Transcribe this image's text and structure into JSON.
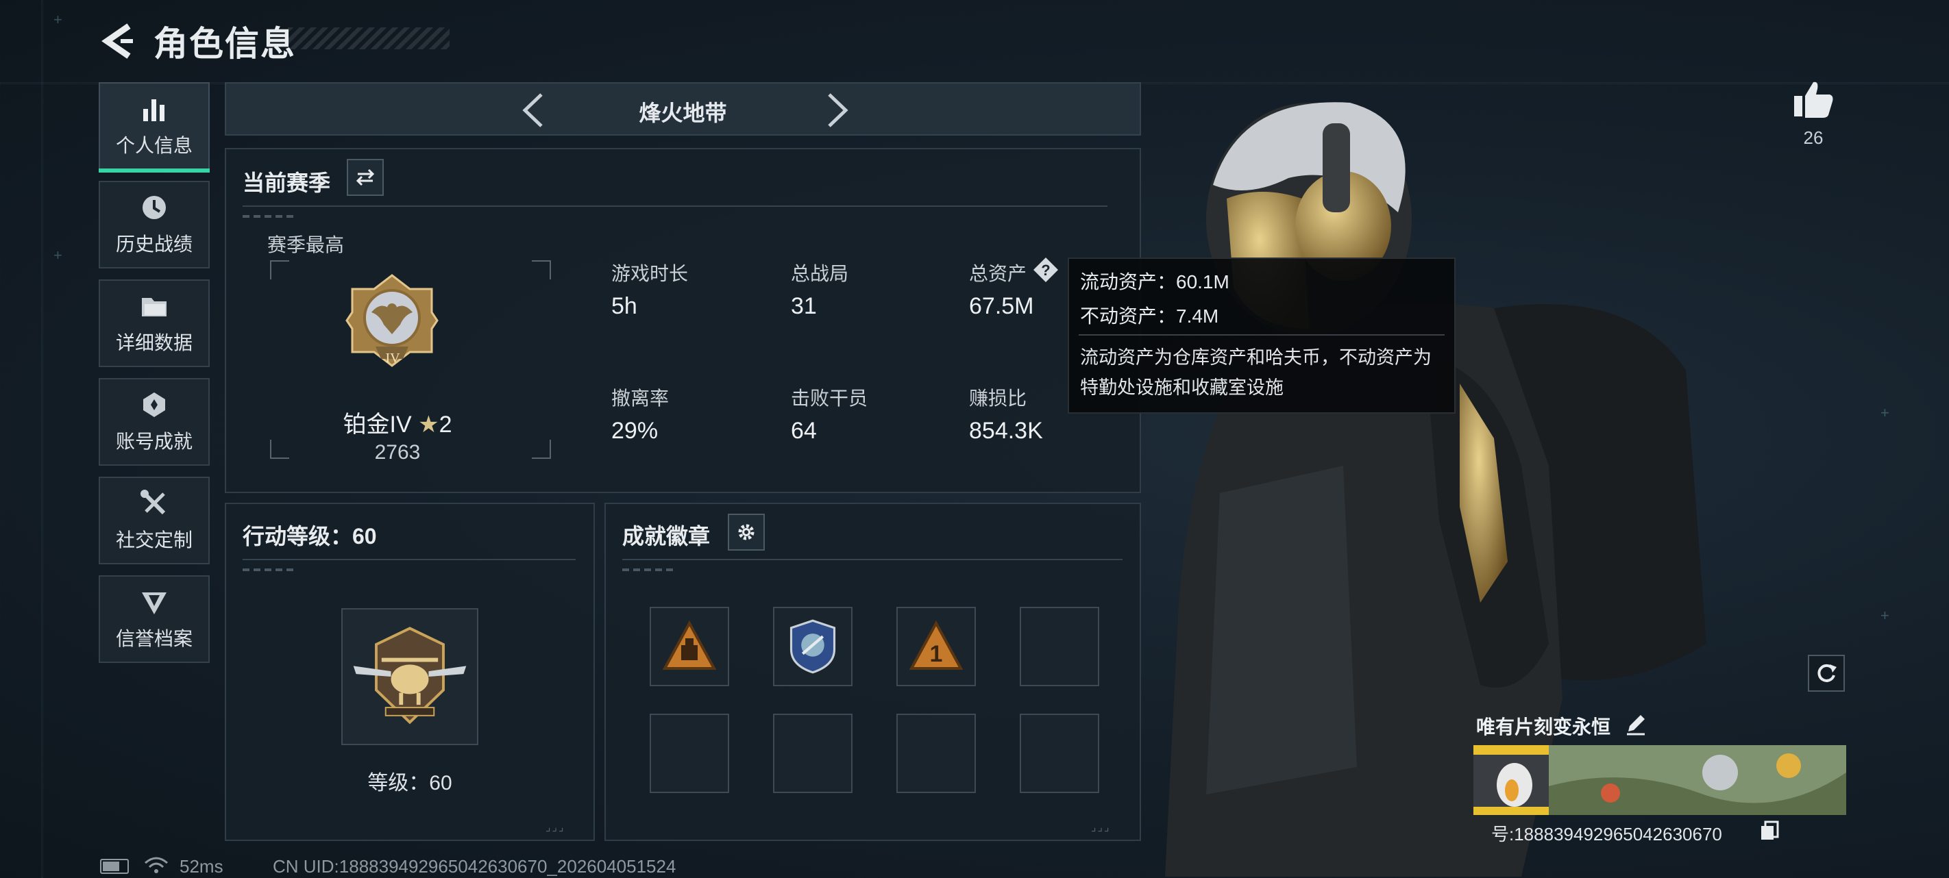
{
  "header": {
    "title": "角色信息"
  },
  "nav": {
    "items": [
      {
        "label": "个人信息",
        "icon": "bar-chart-icon",
        "active": true
      },
      {
        "label": "历史战绩",
        "icon": "history-icon"
      },
      {
        "label": "详细数据",
        "icon": "folder-icon"
      },
      {
        "label": "账号成就",
        "icon": "achievement-icon"
      },
      {
        "label": "社交定制",
        "icon": "tools-icon"
      },
      {
        "label": "信誉档案",
        "icon": "reputation-icon"
      }
    ]
  },
  "mode_selector": {
    "current": "烽火地带"
  },
  "season": {
    "title": "当前赛季",
    "best_label": "赛季最高",
    "rank_name": "铂金IV",
    "rank_stars": "2",
    "rank_score": "2763",
    "rank_emblem_numeral": "IV",
    "stats": [
      {
        "label": "游戏时长",
        "value": "5h"
      },
      {
        "label": "总战局",
        "value": "31"
      },
      {
        "label": "总资产",
        "value": "67.5M"
      },
      {
        "label": "撤离率",
        "value": "29%"
      },
      {
        "label": "击败干员",
        "value": "64"
      },
      {
        "label": "赚损比",
        "value": "854.3K"
      }
    ]
  },
  "tooltip": {
    "liquid": "流动资产：60.1M",
    "fixed": "不动资产：7.4M",
    "description": "流动资产为仓库资产和哈夫币，不动资产为特勤处设施和收藏室设施"
  },
  "action_level": {
    "title": "行动等级：60",
    "level_text": "等级：60"
  },
  "achievements": {
    "title": "成就徽章"
  },
  "likes": {
    "count": "26"
  },
  "profile": {
    "name": "唯有片刻变永恒",
    "id_text": "号:1888394929650426306​70",
    "id_display": "号:188839492965042630670"
  },
  "status_bar": {
    "ping": "52ms",
    "uid": "CN UID:188839492965042630670_202604051524"
  },
  "colors": {
    "accent": "#37d5a5",
    "gold": "#c9a45a"
  }
}
